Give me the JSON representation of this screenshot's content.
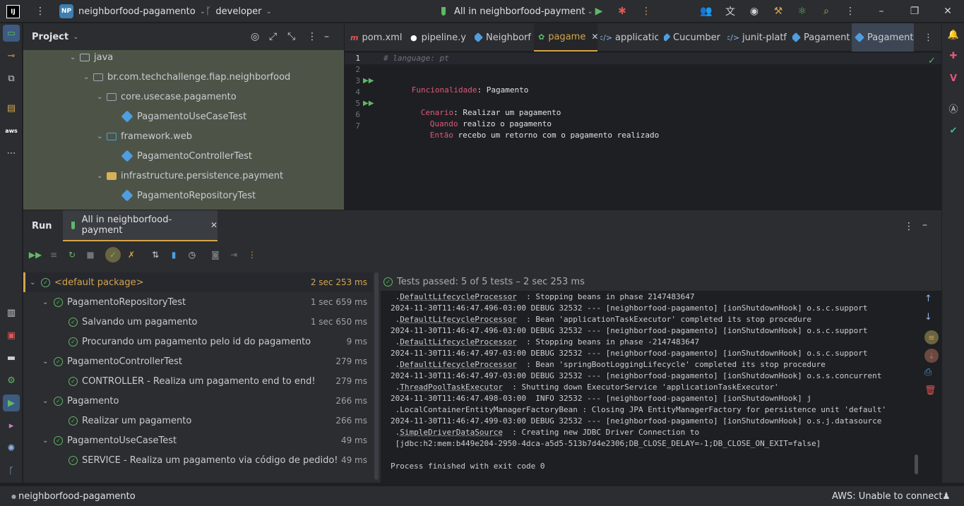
{
  "titlebar": {
    "project_badge": "NP",
    "project_name": "neighborfood-pagamento",
    "branch": "developer",
    "run_config": "All in neighborfood-payment"
  },
  "project_panel": {
    "title": "Project",
    "tree": [
      {
        "label": "java"
      },
      {
        "label": "br.com.techchallenge.fiap.neighborfood"
      },
      {
        "label": "core.usecase.pagamento"
      },
      {
        "label": "PagamentoUseCaseTest"
      },
      {
        "label": "framework.web"
      },
      {
        "label": "PagamentoControllerTest"
      },
      {
        "label": "infrastructure.persistence.payment"
      },
      {
        "label": "PagamentoRepositoryTest"
      }
    ]
  },
  "editor": {
    "tabs": [
      {
        "label": "pom.xml (",
        "icon": "maven-icon"
      },
      {
        "label": "pipeline.y",
        "icon": "github-icon"
      },
      {
        "label": "Neighborf",
        "icon": "class-icon"
      },
      {
        "label": "pagame",
        "icon": "feature-icon"
      },
      {
        "label": "applicatio",
        "icon": "properties-icon"
      },
      {
        "label": "Cucumber",
        "icon": "class-icon"
      },
      {
        "label": "junit-platf",
        "icon": "properties-icon"
      },
      {
        "label": "Pagament",
        "icon": "class-icon"
      },
      {
        "label": "Pagament",
        "icon": "class-icon"
      }
    ],
    "lines": [
      {
        "n": "1",
        "text": "# language: pt"
      },
      {
        "n": "2",
        "text": ""
      },
      {
        "n": "3",
        "kw": "Funcionalidade",
        "rest": ": Pagamento"
      },
      {
        "n": "4",
        "text": ""
      },
      {
        "n": "5",
        "kw": "Cenario",
        "rest": ": Realizar um pagamento"
      },
      {
        "n": "6",
        "kw": "Quando",
        "rest": " realizo o pagamento"
      },
      {
        "n": "7",
        "kw": "Então",
        "rest": " recebo um retorno com o pagamento realizado"
      }
    ]
  },
  "run_window": {
    "label": "Run",
    "tab": "All in neighborfood-payment",
    "status": "Tests passed: 5 of 5 tests – 2 sec 253 ms",
    "tests": [
      {
        "label": "<default package>",
        "time": "2 sec 253 ms"
      },
      {
        "label": "PagamentoRepositoryTest",
        "time": "1 sec 659 ms"
      },
      {
        "label": "Salvando um pagamento",
        "time": "1 sec 650 ms"
      },
      {
        "label": "Procurando um pagamento pelo id do pagamento",
        "time": "9 ms"
      },
      {
        "label": "PagamentoControllerTest",
        "time": "279 ms"
      },
      {
        "label": "CONTROLLER - Realiza um pagamento end to end!",
        "time": "279 ms"
      },
      {
        "label": "Pagamento",
        "time": "266 ms"
      },
      {
        "label": "Realizar um pagamento",
        "time": "266 ms"
      },
      {
        "label": "PagamentoUseCaseTest",
        "time": "49 ms"
      },
      {
        "label": "SERVICE - Realiza um pagamento via código de pedido!",
        "time": "49 ms"
      }
    ],
    "console": [
      {
        "a": " .",
        "u": "DefaultLifecycleProcessor",
        "b": "  : Stopping beans in phase 2147483647"
      },
      {
        "a": "2024-11-30T11:46:47.496-03:00 DEBUG 32532 --- [neighborfood-pagamento] [ionShutdownHook] o.s.c.support",
        "u": "",
        "b": ""
      },
      {
        "a": " .",
        "u": "DefaultLifecycleProcessor",
        "b": "  : Bean 'applicationTaskExecutor' completed its stop procedure"
      },
      {
        "a": "2024-11-30T11:46:47.496-03:00 DEBUG 32532 --- [neighborfood-pagamento] [ionShutdownHook] o.s.c.support",
        "u": "",
        "b": ""
      },
      {
        "a": " .",
        "u": "DefaultLifecycleProcessor",
        "b": "  : Stopping beans in phase -2147483647"
      },
      {
        "a": "2024-11-30T11:46:47.497-03:00 DEBUG 32532 --- [neighborfood-pagamento] [ionShutdownHook] o.s.c.support",
        "u": "",
        "b": ""
      },
      {
        "a": " .",
        "u": "DefaultLifecycleProcessor",
        "b": "  : Bean 'springBootLoggingLifecycle' completed its stop procedure"
      },
      {
        "a": "2024-11-30T11:46:47.497-03:00 DEBUG 32532 --- [neighborfood-pagamento] [ionShutdownHook] o.s.s.concurrent",
        "u": "",
        "b": ""
      },
      {
        "a": " .",
        "u": "ThreadPoolTaskExecutor",
        "b": "  : Shutting down ExecutorService 'applicationTaskExecutor'"
      },
      {
        "a": "2024-11-30T11:46:47.498-03:00  INFO 32532 --- [neighborfood-pagamento] [ionShutdownHook] j",
        "u": "",
        "b": ""
      },
      {
        "a": " .LocalContainerEntityManagerFactoryBean : Closing JPA EntityManagerFactory for persistence unit 'default'",
        "u": "",
        "b": ""
      },
      {
        "a": "2024-11-30T11:46:47.499-03:00 DEBUG 32532 --- [neighborfood-pagamento] [ionShutdownHook] o.s.j.datasource",
        "u": "",
        "b": ""
      },
      {
        "a": " .",
        "u": "SimpleDriverDataSource",
        "b": "  : Creating new JDBC Driver Connection to"
      },
      {
        "a": " [jdbc:h2:mem:b449e204-2950-4dca-a5d5-513b7d4e2306;DB_CLOSE_DELAY=-1;DB_CLOSE_ON_EXIT=false]",
        "u": "",
        "b": ""
      },
      {
        "a": "",
        "u": "",
        "b": ""
      },
      {
        "a": "Process finished with exit code 0",
        "u": "",
        "b": ""
      }
    ]
  },
  "statusbar": {
    "project": "neighborfood-pagamento",
    "aws": "AWS: Unable to connect"
  },
  "colors": {
    "accent_green": "#5fb865",
    "keyword": "#cf8e6d",
    "gherkin_kw": "#e0577a",
    "project_panel_bg": "#4d5447"
  }
}
